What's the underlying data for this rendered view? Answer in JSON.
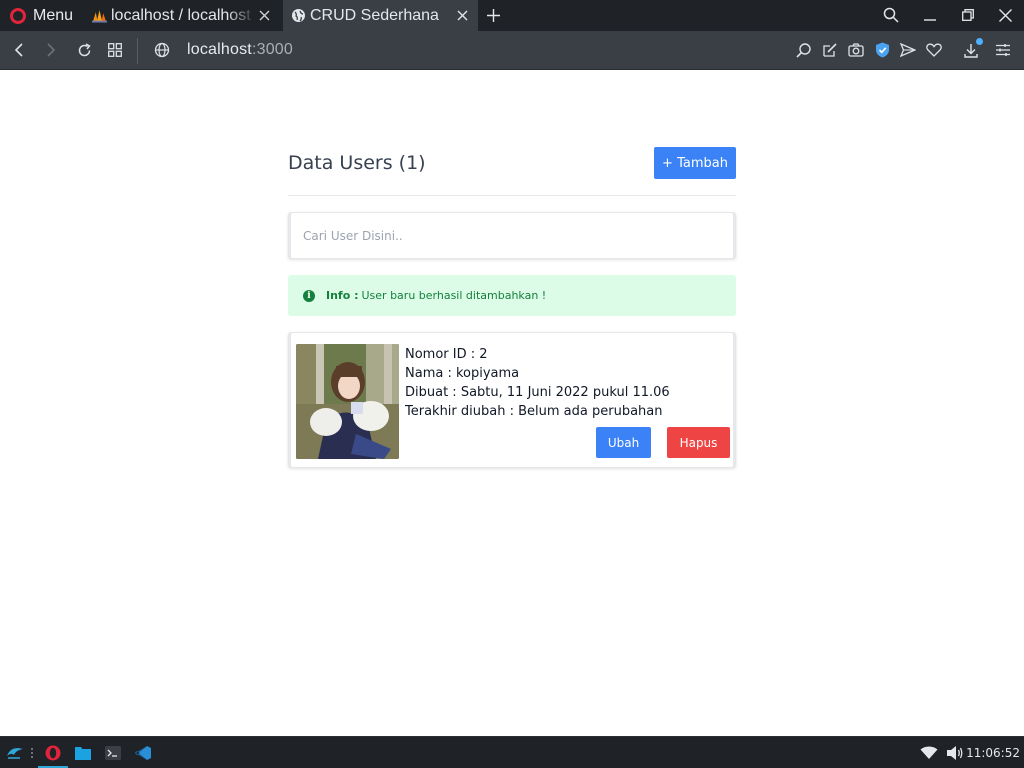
{
  "browser": {
    "menu_label": "Menu",
    "tabs": [
      {
        "title": "localhost / localhost",
        "icon": "phpmyadmin-icon",
        "active": false
      },
      {
        "title": "CRUD Sederhana",
        "icon": "globe-icon",
        "active": true
      }
    ],
    "url_host": "localhost",
    "url_port": ":3000"
  },
  "page": {
    "title": "Data Users (1)",
    "add_button_label": "+ Tambah",
    "search": {
      "placeholder": "Cari User Disini..",
      "value": ""
    },
    "alert": {
      "label": "Info :",
      "message": "User baru berhasil ditambahkan !",
      "color": "#15803d",
      "background": "#dcfce7"
    },
    "users": [
      {
        "id_line": "Nomor ID : 2",
        "name_line": "Nama : kopiyama",
        "created_line": "Dibuat : Sabtu, 11 Juni 2022 pukul 11.06",
        "updated_line": "Terakhir diubah : Belum ada perubahan",
        "edit_label": "Ubah",
        "delete_label": "Hapus"
      }
    ],
    "colors": {
      "primary": "#3b82f6",
      "danger": "#ef4444"
    }
  },
  "taskbar": {
    "clock": "11:06:52"
  }
}
